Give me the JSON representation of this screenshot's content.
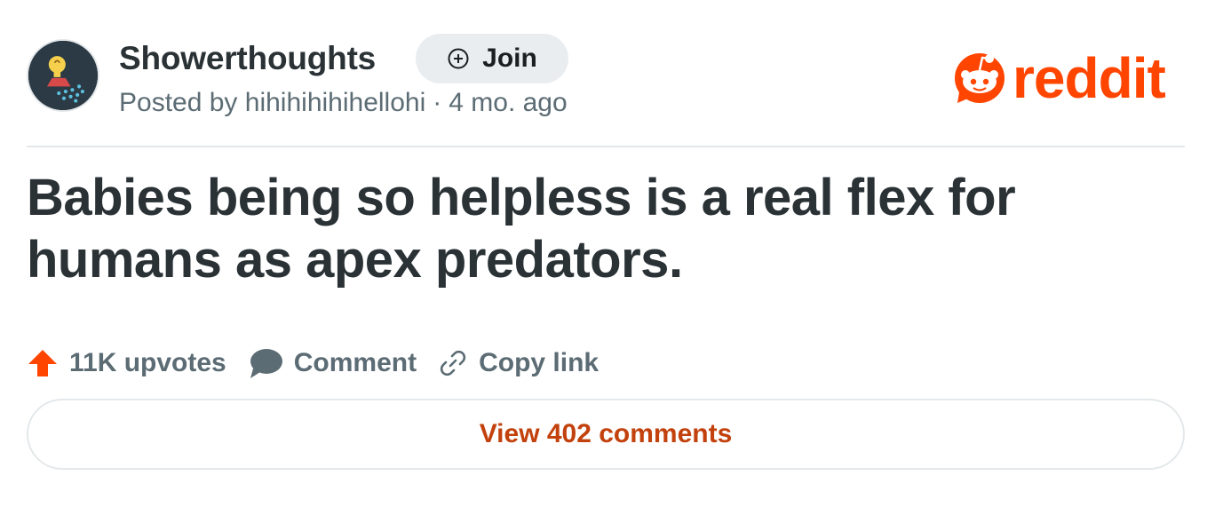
{
  "post": {
    "subreddit": "Showerthoughts",
    "join_label": "Join",
    "posted_by_prefix": "Posted by",
    "author": "hihihihihihellohi",
    "separator": "·",
    "age": "4 mo. ago",
    "title": "Babies being so helpless is a real flex for humans as apex predators."
  },
  "actions": {
    "upvotes": "11K upvotes",
    "comment": "Comment",
    "copy_link": "Copy link"
  },
  "footer": {
    "view_comments": "View 402 comments"
  },
  "brand": {
    "name": "reddit",
    "color": "#ff4500"
  },
  "icons": {
    "avatar": "lightbulb-shower-icon",
    "join": "plus-circle-icon",
    "upvote": "upvote-arrow-icon",
    "comment": "comment-bubble-icon",
    "link": "link-icon",
    "logo": "reddit-logo-icon"
  }
}
